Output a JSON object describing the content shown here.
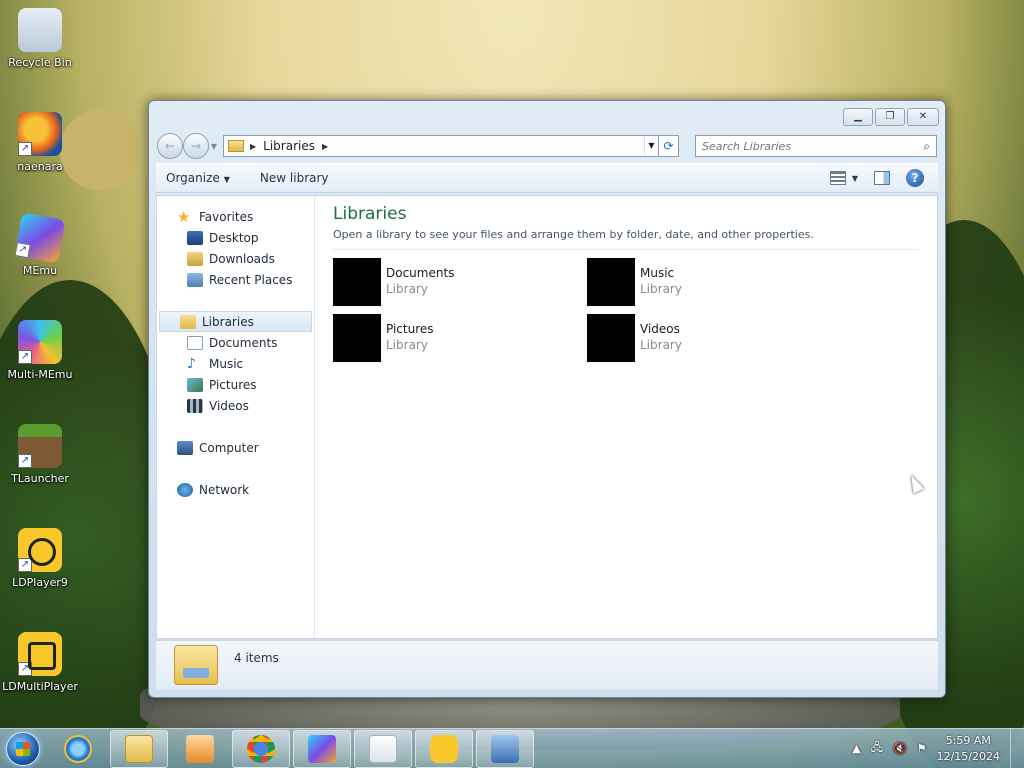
{
  "desktop": {
    "icons": [
      {
        "label": "Recycle Bin"
      },
      {
        "label": "naenara"
      },
      {
        "label": "MEmu"
      },
      {
        "label": "Multi-MEmu"
      },
      {
        "label": "TLauncher"
      },
      {
        "label": "LDPlayer9"
      },
      {
        "label": "LDMultiPlayer"
      }
    ]
  },
  "window": {
    "address": {
      "crumbs": [
        "Libraries"
      ]
    },
    "search": {
      "placeholder": "Search Libraries"
    },
    "toolbar": {
      "organize": "Organize",
      "new_library": "New library"
    },
    "nav": {
      "favorites": "Favorites",
      "desktop": "Desktop",
      "downloads": "Downloads",
      "recent_places": "Recent Places",
      "libraries": "Libraries",
      "documents": "Documents",
      "music": "Music",
      "pictures": "Pictures",
      "videos": "Videos",
      "computer": "Computer",
      "network": "Network"
    },
    "main": {
      "title": "Libraries",
      "description": "Open a library to see your files and arrange them by folder, date, and other properties.",
      "items": [
        {
          "name": "Documents",
          "type": "Library"
        },
        {
          "name": "Music",
          "type": "Library"
        },
        {
          "name": "Pictures",
          "type": "Library"
        },
        {
          "name": "Videos",
          "type": "Library"
        }
      ]
    },
    "details": {
      "count": "4 items"
    }
  },
  "taskbar": {
    "clock": {
      "time": "5:59 AM",
      "date": "12/15/2024"
    }
  },
  "colors": {
    "title_green": "#1e6e3a",
    "taskbar": "#7aa2b8"
  }
}
